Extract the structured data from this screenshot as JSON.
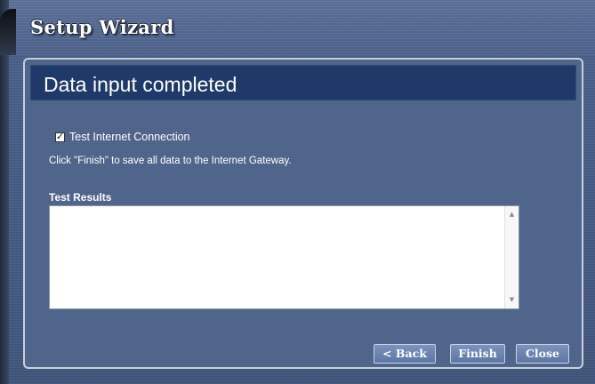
{
  "wizard": {
    "title": "Setup Wizard"
  },
  "panel": {
    "title": "Data input completed"
  },
  "test_connection": {
    "label": "Test Internet Connection",
    "checked": true,
    "mark": "✓"
  },
  "hint": "Click \"Finish\" to save all data to the Internet Gateway.",
  "results": {
    "label": "Test Results",
    "value": "",
    "scroll_up": "▲",
    "scroll_down": "▼"
  },
  "buttons": {
    "back": "< Back",
    "finish": "Finish",
    "close": "Close"
  },
  "colors": {
    "frame": "#4a6089",
    "header": "#1f3a68",
    "button": "#6a83af"
  }
}
